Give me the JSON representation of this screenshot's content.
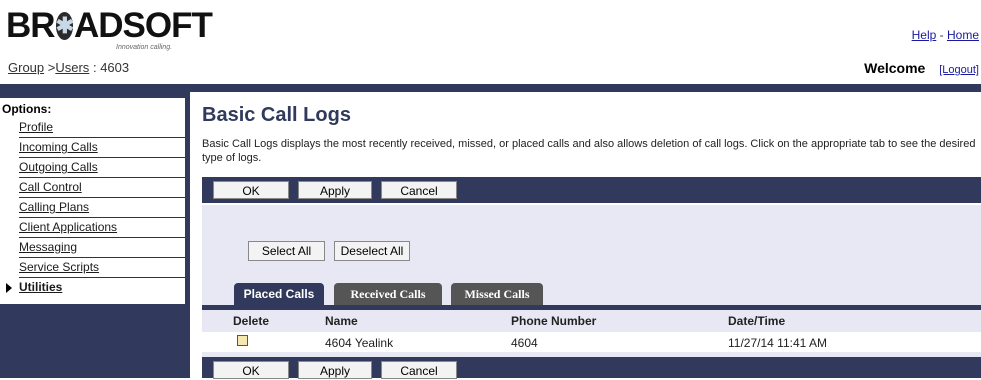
{
  "header": {
    "logo": {
      "text_left": "BR",
      "text_right": "ADSOFT",
      "tagline": "Innovation calling."
    },
    "links": {
      "help": "Help",
      "separator": "-",
      "home": "Home"
    },
    "breadcrumb": {
      "group": "Group",
      "sep1": ">",
      "users": "Users",
      "sep2": ":",
      "user_id": "4603"
    },
    "welcome": "Welcome",
    "logout": "[Logout]"
  },
  "sidebar": {
    "title": "Options:",
    "items": [
      {
        "label": "Profile"
      },
      {
        "label": "Incoming Calls"
      },
      {
        "label": "Outgoing Calls"
      },
      {
        "label": "Call Control"
      },
      {
        "label": "Calling Plans"
      },
      {
        "label": "Client Applications"
      },
      {
        "label": "Messaging"
      },
      {
        "label": "Service Scripts"
      },
      {
        "label": "Utilities"
      }
    ]
  },
  "main": {
    "title": "Basic Call Logs",
    "description": "Basic Call Logs displays the most recently received, missed, or placed calls and also allows deletion of call logs. Click on the appropriate tab to see the desired type of logs.",
    "buttons": {
      "ok": "OK",
      "apply": "Apply",
      "cancel": "Cancel"
    },
    "select_all": "Select All",
    "deselect_all": "Deselect All",
    "tabs": [
      {
        "label": "Placed Calls",
        "active": true
      },
      {
        "label": "Received Calls",
        "active": false
      },
      {
        "label": "Missed Calls",
        "active": false
      }
    ],
    "table": {
      "headers": [
        "Delete",
        "Name",
        "Phone Number",
        "Date/Time"
      ],
      "rows": [
        {
          "delete": false,
          "name": "4604 Yealink",
          "phone": "4604",
          "datetime": "11/27/14 11:41 AM"
        }
      ]
    }
  },
  "colors": {
    "navy": "#313a5c",
    "panel": "#e8e8f4",
    "link": "#1a1aa0"
  }
}
